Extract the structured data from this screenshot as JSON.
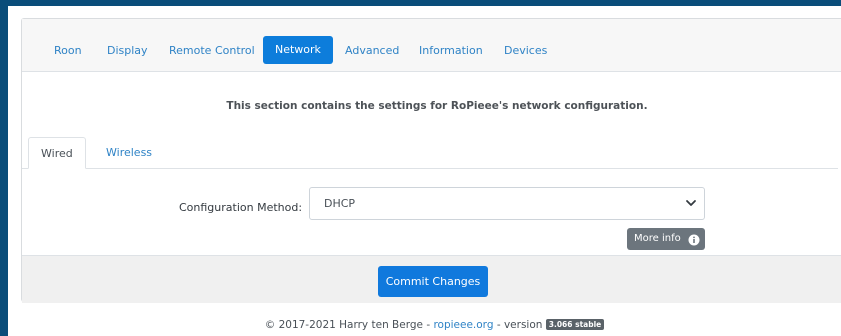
{
  "nav": {
    "tabs": [
      {
        "label": "Roon"
      },
      {
        "label": "Display"
      },
      {
        "label": "Remote Control"
      },
      {
        "label": "Network"
      },
      {
        "label": "Advanced"
      },
      {
        "label": "Information"
      },
      {
        "label": "Devices"
      }
    ],
    "active": "Network"
  },
  "section": {
    "description": "This section contains the settings for RoPieee's network configuration."
  },
  "subtabs": {
    "items": [
      {
        "label": "Wired"
      },
      {
        "label": "Wireless"
      }
    ],
    "active": "Wired"
  },
  "form": {
    "config_label": "Configuration Method:",
    "config_value": "DHCP",
    "more_info_label": "More info"
  },
  "actions": {
    "commit_label": "Commit Changes"
  },
  "footer": {
    "copyright": "© 2017-2021 Harry ten Berge - ",
    "link": "ropieee.org",
    "version_prefix": " - version ",
    "version_badge": "3.066 stable"
  },
  "colors": {
    "background": "#0a4d7a",
    "accent": "#0d7ddb",
    "link": "#2f83c6",
    "secondary_button": "#6c757d"
  }
}
